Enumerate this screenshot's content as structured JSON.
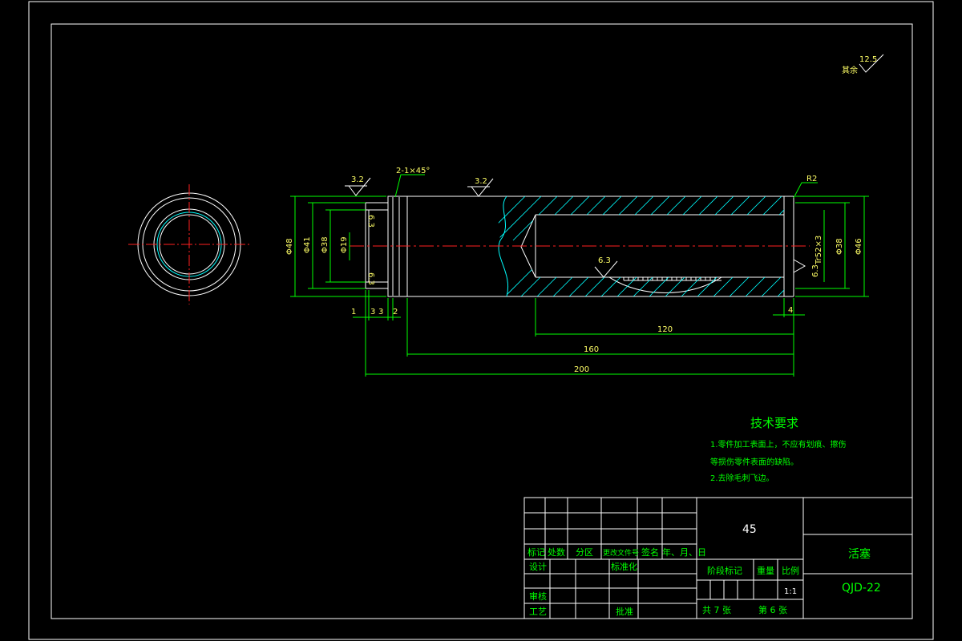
{
  "drawing": {
    "surface_finish_other": {
      "label": "其余",
      "value": "12.5"
    },
    "roughness_marks": [
      "3.2",
      "3.2",
      "6.3",
      "6.3",
      "6.3",
      "6.3"
    ],
    "chamfer_note": "2-1×45°",
    "edge_note": "R2",
    "thread_note": "Tr52×3",
    "diameter_labels": [
      "Φ48",
      "Φ41",
      "Φ38",
      "Φ19",
      "Φ38",
      "Φ46"
    ],
    "dimensions": {
      "d120": "120",
      "d160": "160",
      "d200": "200",
      "d4": "4",
      "d1": "1",
      "d3a": "3",
      "d3b": "3",
      "d2": "2"
    }
  },
  "tech_req": {
    "title": "技术要求",
    "line1": "1.零件加工表面上，不应有划痕、擦伤",
    "line2": "等损伤零件表面的缺陷。",
    "line3": "2.去除毛刺飞边。"
  },
  "title_block": {
    "material": "45",
    "part_name": "活塞",
    "drawing_no": "QJD-22",
    "headers": {
      "mark": "标记",
      "count": "处数",
      "zone": "分区",
      "doc": "更改文件号",
      "sign": "签名",
      "date": "年、月、日"
    },
    "rows": {
      "design": "设计",
      "standard": "标准化",
      "review": "审核",
      "process": "工艺",
      "approve": "批准"
    },
    "stage": "阶段标记",
    "weight": "重量",
    "scale_label": "比例",
    "scale": "1:1",
    "total_sheets": "共 7 张",
    "sheet_no": "第 6 张"
  }
}
